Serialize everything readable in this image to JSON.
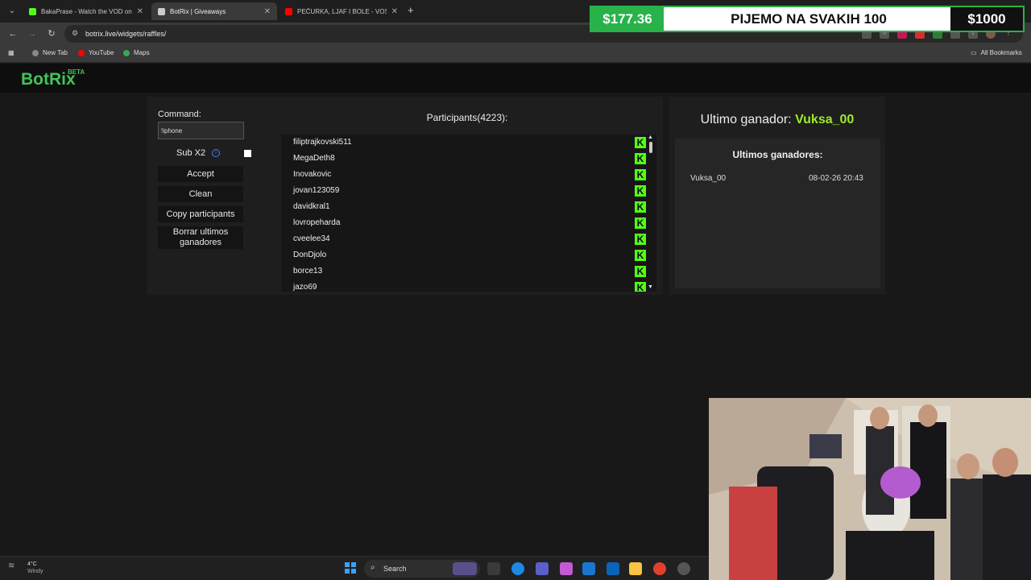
{
  "browser": {
    "tabs": [
      {
        "title": "BakaPrase - Watch the VOD on",
        "favicon_color": "#53fc18",
        "active": false
      },
      {
        "title": "BotRix | Giveaways",
        "favicon_color": "#cccccc",
        "active": true
      },
      {
        "title": "PEČURKA, LJAF I BOLE - VOSTC",
        "favicon_color": "#ff0000",
        "active": false
      }
    ],
    "url": "botrix.live/widgets/raffles/",
    "bookmarks": [
      {
        "label": "New Tab",
        "color": "#888888"
      },
      {
        "label": "YouTube",
        "color": "#ff0000"
      },
      {
        "label": "Maps",
        "color": "#34a853"
      }
    ],
    "all_bookmarks": "All Bookmarks"
  },
  "overlay": {
    "left_amount": "$177.36",
    "message": "PIJEMO NA SVAKIH 100",
    "right_amount": "$1000"
  },
  "header": {
    "logo": "BotRix",
    "badge": "BETA"
  },
  "controls": {
    "command_label": "Command:",
    "command_value": "!iphone",
    "sub_label": "Sub X2",
    "sub_checked": false,
    "buttons": {
      "accept": "Accept",
      "clean": "Clean",
      "copy": "Copy participants",
      "clear_winners": "Borrar ultimos ganadores"
    }
  },
  "participants": {
    "title": "Participants(4223):",
    "platform_icon": "kick-icon",
    "accent": "#53fc18",
    "items": [
      "filiptrajkovski511",
      "MegaDeth8",
      "Inovakovic",
      "jovan123059",
      "davidkral1",
      "lovropeharda",
      "cveelee34",
      "DonDjolo",
      "borce13",
      "jazo69"
    ]
  },
  "winners": {
    "last_winner_label": "Ultimo ganador:",
    "last_winner": "Vuksa_00",
    "list_title": "Ultimos ganadores:",
    "list": [
      {
        "name": "Vuksa_00",
        "date": "08-02-26 20:43"
      }
    ]
  },
  "taskbar": {
    "temperature": "4°C",
    "condition": "Windy",
    "search_placeholder": "Search"
  }
}
